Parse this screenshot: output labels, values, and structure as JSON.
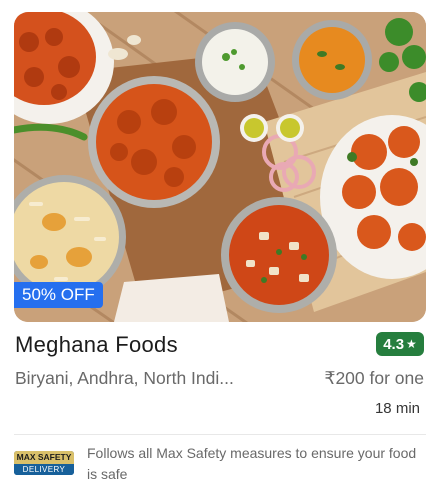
{
  "card": {
    "image_alt": "Meghana Foods food spread",
    "offer": "50% OFF",
    "name": "Meghana Foods",
    "rating": "4.3",
    "rating_icon": "star-icon",
    "cuisines": "Biryani, Andhra, North Indi...",
    "price": "₹200 for one",
    "delivery_time": "18 min",
    "safety_badge": {
      "line1": "MAX SAFETY",
      "line2": "DELIVERY"
    },
    "safety_text": "Follows all Max Safety measures to ensure your food is safe"
  },
  "colors": {
    "offer_bg": "#256fef",
    "rating_bg": "#267e3e",
    "text_primary": "#1c1c1c",
    "text_secondary": "#696969"
  }
}
